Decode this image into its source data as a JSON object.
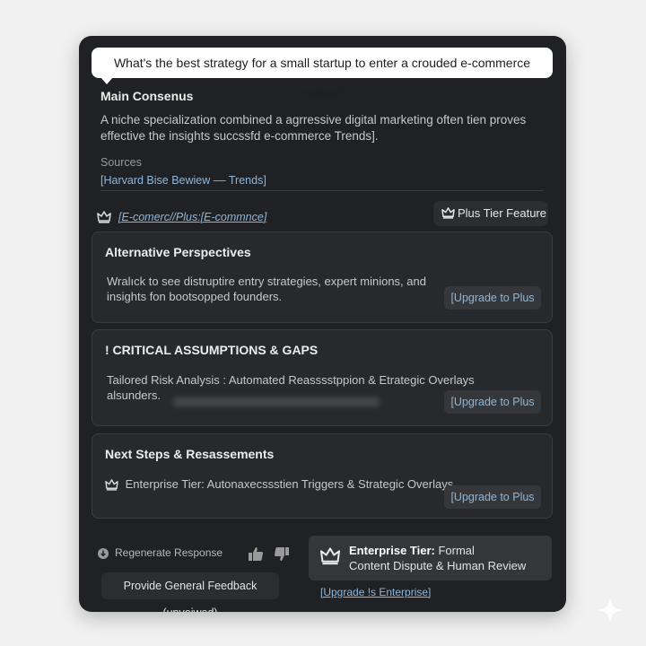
{
  "question": "What's the best strategy for a small startup to enter a crouded e-commerce market?",
  "consensus": {
    "title": "Main Consenus",
    "body_line1": "A niche specialization combined a agrressive digital marketing often tien proves",
    "body_line2": "effective the insights succssfd e-commerce Trends].",
    "sources_label": "Sources",
    "source_link": "[Harvard Bise Bewiew –– Trends]"
  },
  "category": {
    "icon": "crown-icon",
    "link": "[E-comerc//Plus:[E-commnce]"
  },
  "tier_badge": {
    "icon": "crown-icon",
    "label": "Plus Tier Feature"
  },
  "cards": {
    "alternative": {
      "title": "Alternative Perspectives",
      "body_line1": "Wralıck to see distruptire entry strategies, expert minions, and",
      "body_line2": "insights fon bootsopped founders.",
      "button": "[Upgrade to Plus"
    },
    "critical": {
      "title": "! CRITICAL ASSUMPTIONS & GAPS",
      "body_line1": "Tailored Risk Analysis : Automated Reasssstppion & Etrategic Overlays",
      "body_line2": "alsunders.",
      "button": "[Upgrade to Plus"
    },
    "next_steps": {
      "title": "Next Steps & Resassements",
      "body": "Enterprise Tier: Autonaxecssstien Triggers & Strategic Overlays",
      "icon": "crown-icon",
      "button": "[Upgrade to Plus"
    }
  },
  "footer": {
    "regenerate": "Regenerate Response",
    "feedback": "Provide General Feedback (unveiwed)",
    "enterprise_bold": "Enterprise Tier:",
    "enterprise_rest1": " Formal",
    "enterprise_line2": "Content Dispute & Human Review",
    "enterprise_link": "[Upgrade !s Enterprise]"
  },
  "colors": {
    "panel_bg": "#202124",
    "card_bg": "#28292c",
    "link": "#8fb6d8",
    "page_bg": "#f1f1f1"
  }
}
